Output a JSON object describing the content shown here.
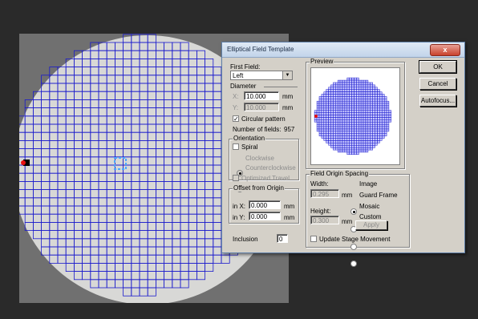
{
  "dialog": {
    "title": "Elliptical Field Template",
    "close_label": "x",
    "first_field_label": "First Field:",
    "first_field_value": "Left",
    "diameter_label": "Diameter",
    "x_label": "X:",
    "x_value": "10.000",
    "x_unit": "mm",
    "y_label": "Y:",
    "y_value": "10.000",
    "y_unit": "mm",
    "circular_label": "Circular pattern",
    "circular_checked": true,
    "num_fields_label": "Number of fields:",
    "num_fields_value": "957",
    "orientation_label": "Orientation",
    "spiral_label": "Spiral",
    "clockwise_label": "Clockwise",
    "counterclockwise_label": "Counterclockwise",
    "optimized_label": "Optimized Travel",
    "offset_label": "Offset from Origin",
    "inx_label": "in X:",
    "inx_value": "0.000",
    "inx_unit": "mm",
    "iny_label": "in Y:",
    "iny_value": "0.000",
    "iny_unit": "mm",
    "inclusion_label": "Inclusion",
    "inclusion_value": "0",
    "preview_label": "Preview",
    "spacing_label": "Field Origin Spacing",
    "width_label": "Width:",
    "width_value": "0.295",
    "width_unit": "mm",
    "height_label": "Height:",
    "height_value": "0.300",
    "height_unit": "mm",
    "image_label": "Image",
    "guard_label": "Guard Frame",
    "mosaic_label": "Mosaic",
    "custom_label": "Custom",
    "apply_label": "Apply",
    "update_label": "Update Stage Movement",
    "ok_label": "OK",
    "cancel_label": "Cancel",
    "autofocus_label": "Autofocus..."
  },
  "colors": {
    "grid": "#1a1acc",
    "marker": "#e81010"
  }
}
